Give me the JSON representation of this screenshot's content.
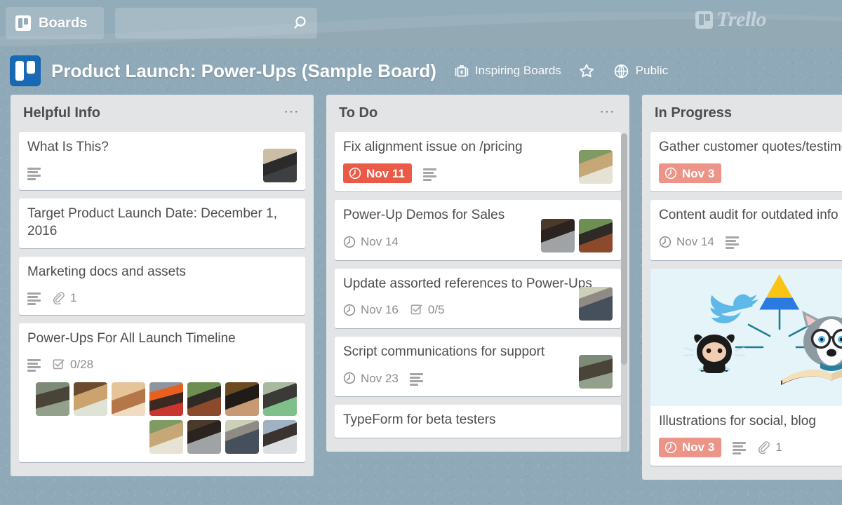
{
  "colors": {
    "board_background": "#8fa9b8",
    "topbar": "#93acb9",
    "list_background": "#e2e4e6",
    "card_background": "#ffffff",
    "due_overdue": "#eb5a46",
    "due_soon": "#ec9488",
    "logo_blue": "#1769b3",
    "cover_blue": "#e4f4f9"
  },
  "topbar": {
    "boards_label": "Boards",
    "boards_icon": "trello-board-icon",
    "search_value": "",
    "search_placeholder": "",
    "search_icon": "search-icon",
    "brand_word": "Trello",
    "brand_icon": "trello-logo-icon"
  },
  "board_header": {
    "logo_icon": "trello-logo-icon",
    "title": "Product Launch: Power-Ups (Sample Board)",
    "team": {
      "icon": "briefcase-icon",
      "label": "Inspiring Boards"
    },
    "star": {
      "icon": "star-icon",
      "label": ""
    },
    "visibility": {
      "icon": "globe-icon",
      "label": "Public"
    }
  },
  "lists": [
    {
      "title": "Helpful Info",
      "menu_icon": "ellipsis-icon",
      "has_scrollbar": false,
      "cards": [
        {
          "title": "What Is This?",
          "badges": [
            {
              "type": "description",
              "icon": "description-icon"
            }
          ],
          "members": [
            "member-bearded-glasses"
          ],
          "members_position": "right"
        },
        {
          "title": "Target Product Launch Date: December 1, 2016",
          "badges": [],
          "members": []
        },
        {
          "title": "Marketing docs and assets",
          "badges": [
            {
              "type": "description",
              "icon": "description-icon"
            },
            {
              "type": "attachment",
              "icon": "paperclip-icon",
              "count": "1"
            }
          ],
          "members": []
        },
        {
          "title": "Power-Ups For All Launch Timeline",
          "badges": [
            {
              "type": "description",
              "icon": "description-icon"
            },
            {
              "type": "checklist",
              "icon": "checklist-icon",
              "count": "0/28"
            }
          ],
          "members": [
            "member-cap-beard",
            "member-blonde-glasses",
            "member-smiling-woman",
            "member-orange-cap",
            "member-headband-woman",
            "member-dark-hair-woman",
            "member-green-shirt-man",
            "member-glasses-blonde",
            "member-grey-shirt-man",
            "member-fedora-man",
            "member-backpack-man"
          ],
          "members_position": "wrap"
        }
      ]
    },
    {
      "title": "To Do",
      "menu_icon": "ellipsis-icon",
      "has_scrollbar": true,
      "cards": [
        {
          "title": "Fix alignment issue on /pricing",
          "badges": [
            {
              "type": "due",
              "icon": "clock-icon",
              "label": "Nov 11",
              "style": "overdue"
            },
            {
              "type": "description",
              "icon": "description-icon"
            }
          ],
          "members": [
            "member-glasses-blonde"
          ],
          "members_position": "right"
        },
        {
          "title": "Power-Up Demos for Sales",
          "badges": [
            {
              "type": "due",
              "icon": "clock-icon",
              "label": "Nov 14",
              "style": "plain"
            }
          ],
          "members": [
            "member-grey-shirt-man",
            "member-headband-woman"
          ],
          "members_position": "right"
        },
        {
          "title": "Update assorted references to Power-Ups",
          "badges": [
            {
              "type": "due",
              "icon": "clock-icon",
              "label": "Nov 16",
              "style": "plain"
            },
            {
              "type": "checklist",
              "icon": "checklist-icon",
              "count": "0/5"
            }
          ],
          "members": [
            "member-fedora-man"
          ],
          "members_position": "right"
        },
        {
          "title": "Script communications for support",
          "badges": [
            {
              "type": "due",
              "icon": "clock-icon",
              "label": "Nov 23",
              "style": "plain"
            },
            {
              "type": "description",
              "icon": "description-icon"
            }
          ],
          "members": [
            "member-cap-beard"
          ],
          "members_position": "right"
        },
        {
          "title": "TypeForm for beta testers",
          "badges": [],
          "members": []
        }
      ]
    },
    {
      "title": "In Progress",
      "menu_icon": "ellipsis-icon",
      "has_scrollbar": false,
      "cards": [
        {
          "title": "Gather customer quotes/testimonials",
          "badges": [
            {
              "type": "due",
              "icon": "clock-icon",
              "label": "Nov 3",
              "style": "soon"
            }
          ],
          "members": []
        },
        {
          "title": "Content audit for outdated info",
          "badges": [
            {
              "type": "due",
              "icon": "clock-icon",
              "label": "Nov 14",
              "style": "plain"
            },
            {
              "type": "description",
              "icon": "description-icon"
            }
          ],
          "members": []
        },
        {
          "title": "Illustrations for social, blog",
          "cover": "power-ups-integrations-illustration",
          "badges": [
            {
              "type": "due",
              "icon": "clock-icon",
              "label": "Nov 3",
              "style": "soon"
            },
            {
              "type": "description",
              "icon": "description-icon"
            },
            {
              "type": "attachment",
              "icon": "paperclip-icon",
              "count": "1"
            }
          ],
          "members": []
        }
      ]
    }
  ]
}
